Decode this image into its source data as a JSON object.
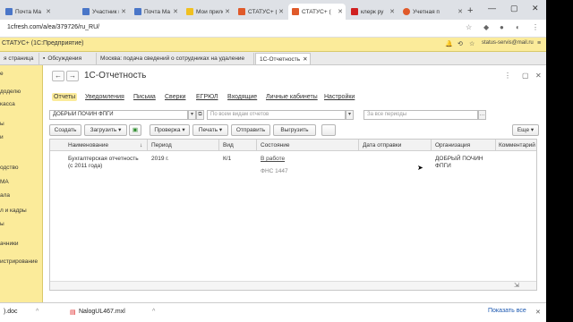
{
  "browser": {
    "tabs": [
      {
        "title": "Почта Ма",
        "color": "#4a76c8",
        "active": false
      },
      {
        "title": "Участник к",
        "color": "#4a76c8",
        "active": false
      },
      {
        "title": "Почта Ма",
        "color": "#4a76c8",
        "active": false
      },
      {
        "title": "Мои прилож",
        "color": "#f0c020",
        "active": false
      },
      {
        "title": "СТАТУС+ (",
        "color": "#e05a2a",
        "active": false
      },
      {
        "title": "СТАТУС+ (",
        "color": "#e05a2a",
        "active": true
      },
      {
        "title": "клерк ру",
        "color": "#d02020",
        "active": false
      },
      {
        "title": "Учетная п",
        "color": "#e05a2a",
        "active": false
      }
    ],
    "new_tab": "+",
    "url": "1cfresh.com/a/ea/379726/ru_RU/",
    "win_min": "—",
    "win_max": "▢",
    "win_close": "✕"
  },
  "app": {
    "title": "СТАТУС+ (1С:Предприятие)",
    "user": "status-servis@mail.ru"
  },
  "open_tabs": [
    {
      "label": "я страница",
      "active": false
    },
    {
      "label": "Обсуждения",
      "active": false
    },
    {
      "label": "Москва: подача сведений о сотрудниках на удаление",
      "active": false
    },
    {
      "label": "1С-Отчетность",
      "active": true
    }
  ],
  "sidebar": {
    "items": [
      "е",
      "доделю",
      "касса",
      "ы",
      "и",
      "одство",
      "МА",
      "ала",
      "л и кадры",
      "ы",
      "ачники",
      "истрирование"
    ]
  },
  "form": {
    "back": "←",
    "forward": "→",
    "title": "1С-Отчетность",
    "sections": [
      "Отчеты",
      "Уведомления",
      "Письма",
      "Сверки",
      "ЕГРЮЛ",
      "Входящие",
      "Личные кабинеты",
      "Настройки"
    ],
    "org_value": "ДОБРЫЙ ПОЧИН ФПГИ",
    "kind_placeholder": "По всем видам отчетов",
    "period_placeholder": "За все периоды",
    "buttons": {
      "create": "Создать",
      "load": "Загрузить",
      "check": "Проверка",
      "print": "Печать",
      "send": "Отправить",
      "unload": "Выгрузить",
      "more": "Еще"
    }
  },
  "table": {
    "headers": [
      "Наименование",
      "Период",
      "Вид",
      "Состояние",
      "Дата отправки",
      "Организация",
      "Комментарий"
    ],
    "sort_icon": "↓",
    "rows": [
      {
        "name_line1": "Бухгалтерская отчетность",
        "name_line2": "(с 2011 года)",
        "period": "2019 г.",
        "kind": "К/1",
        "state": "В работе",
        "state_sub": "ФНС 1447",
        "date": "",
        "org_line1": "ДОБРЫЙ ПОЧИН",
        "org_line2": "ФПГИ",
        "comment": ""
      }
    ]
  },
  "downloads": {
    "item1": ").doc",
    "item2": "NalogUL467.mxl",
    "show_all": "Показать все"
  }
}
